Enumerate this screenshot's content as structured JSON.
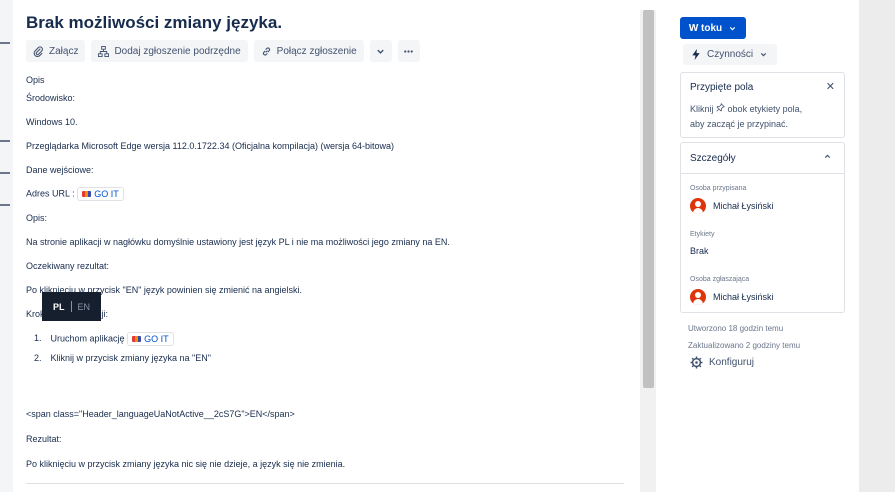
{
  "issue": {
    "title": "Brak możliwości zmiany języka.",
    "toolbar": {
      "attach": "Załącz",
      "add_child": "Dodaj zgłoszenie podrzędne",
      "link_issue": "Połącz zgłoszenie"
    },
    "description": {
      "heading": "Opis",
      "env_label": "Środowisko:",
      "os": "Windows 10.",
      "browser": "Przeglądarka Microsoft Edge wersja 112.0.1722.34 (Oficjalna kompilacja) (wersja 64-bitowa)",
      "input_label": "Dane wejściowe:",
      "url_label": "Adres URL :",
      "url_chip": "GO IT",
      "desc_label": "Opis:",
      "desc_text": "Na stronie aplikacji w nagłówku domyślnie ustawiony jest język PL i nie ma możliwości jego zmiany na EN.",
      "expected_label": "Oczekiwany rezultat:",
      "expected_text": "Po kliknięciu w przycisk \"EN\" język powinien się zmienić na angielski.",
      "steps_label": "Kroki do reprodukcji:",
      "step1_num": "1.",
      "step1": "Uruchom aplikację",
      "step1_chip": "GO IT",
      "step2_num": "2.",
      "step2": "Kliknij w przycisk zmiany języka na \"EN\"",
      "lang_pl": "PL",
      "lang_en": "EN",
      "code_line": "<span class=\"Header_languageUaNotActive__2cS7G\">EN</span>",
      "result_label": "Rezultat:",
      "result_text": "Po kliknięciu w przycisk zmiany języka nic się nie dzieje, a język się nie zmienia."
    }
  },
  "sidebar": {
    "status": "W toku",
    "actions": "Czynności",
    "pinned": {
      "title": "Przypięte pola",
      "hint_line1": "Kliknij",
      "hint_line1b": "obok etykiety pola,",
      "hint_line2": "aby zacząć je przypinać."
    },
    "details": {
      "title": "Szczegóły",
      "assignee_label": "Osoba przypisana",
      "assignee": "Michał Łysiński",
      "labels_label": "Etykiety",
      "labels_value": "Brak",
      "reporter_label": "Osoba zgłaszająca",
      "reporter": "Michał Łysiński"
    },
    "created": "Utworzono 18 godzin temu",
    "updated": "Zaktualizowano 2 godziny temu",
    "configure": "Konfiguruj"
  },
  "colors": {
    "primary": "#0052cc",
    "text": "#172b4d",
    "avatar": "#de350b",
    "lang_toggle_bg": "#161f2e"
  }
}
